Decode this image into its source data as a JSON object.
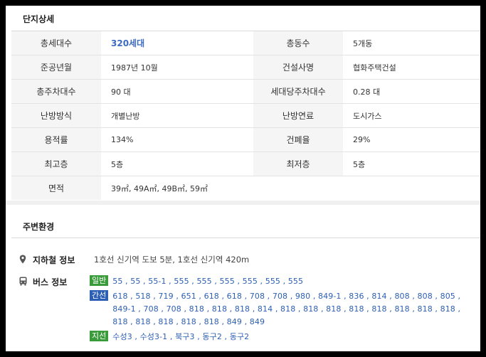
{
  "section1_title": "단지상세",
  "rows": [
    {
      "l1": "총세대수",
      "v1": "320세대",
      "l2": "총동수",
      "v2": "5개동"
    },
    {
      "l1": "준공년월",
      "v1": "1987년 10월",
      "l2": "건설사명",
      "v2": "협화주택건설"
    },
    {
      "l1": "총주차대수",
      "v1": "90 대",
      "l2": "세대당주차대수",
      "v2": "0.28 대"
    },
    {
      "l1": "난방방식",
      "v1": "개별난방",
      "l2": "난방연료",
      "v2": "도시가스"
    },
    {
      "l1": "용적률",
      "v1": "134%",
      "l2": "건폐율",
      "v2": "29%"
    },
    {
      "l1": "최고층",
      "v1": "5층",
      "l2": "최저층",
      "v2": "5층"
    },
    {
      "l1": "면적",
      "v1": "39㎡, 49A㎡, 49B㎡, 59㎡"
    }
  ],
  "section2_title": "주변환경",
  "subway": {
    "label": "지하철 정보",
    "text": "1호선 신기역 도보 5분, 1호선 신기역 420m",
    "icon": "map-pin-icon"
  },
  "bus": {
    "label": "버스 정보",
    "icon": "bus-icon",
    "lines": [
      {
        "badge": "일반",
        "color": "#3a9b3a",
        "routes": "55 , 55 , 55-1 , 555 , 555 , 555 , 555 , 555 , 555"
      },
      {
        "badge": "간선",
        "color": "#2d5fb4",
        "routes": "618 , 518 , 719 , 651 , 618 , 618 , 708 , 708 , 980 , 849-1 , 836 , 814 , 808 , 808 , 805 , 849-1 , 708 , 708 , 818 , 818 , 818 , 814 , 818 , 818 , 818 , 818 , 818 , 818 , 818 , 818 , 818 , 818 , 818 , 818 , 818 , 849 , 849"
      },
      {
        "badge": "지선",
        "color": "#3a9b3a",
        "routes": "수성3 , 수성3-1 , 북구3 , 동구2 , 동구2"
      }
    ]
  }
}
